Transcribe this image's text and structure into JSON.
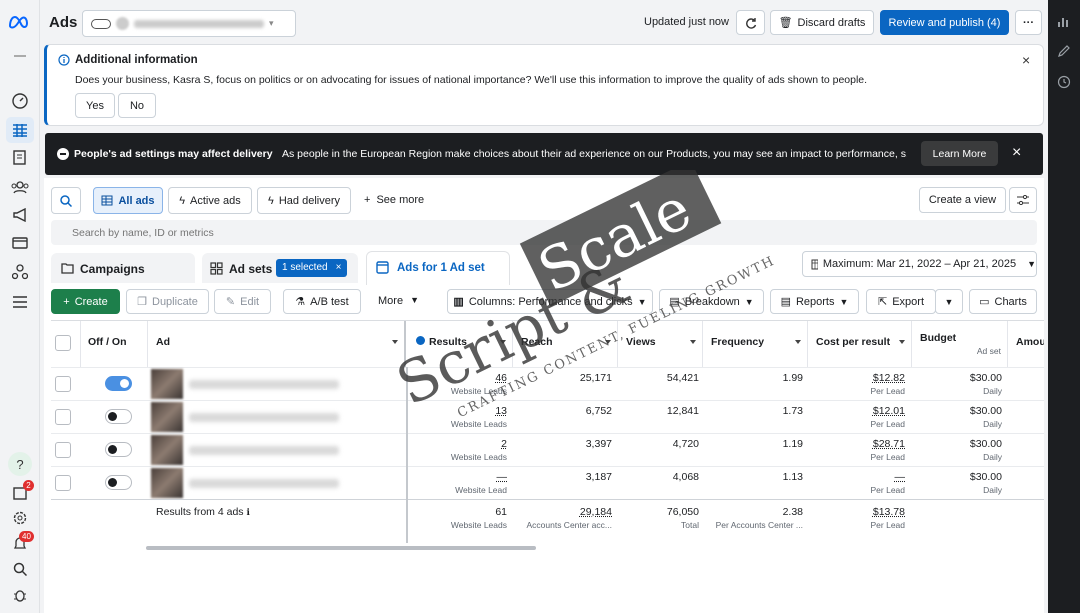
{
  "topbar": {
    "title": "Ads",
    "updated": "Updated just now",
    "discard": "Discard drafts",
    "review": "Review and publish (4)"
  },
  "info": {
    "title": "Additional information",
    "text": "Does your business, Kasra S, focus on politics or on advocating for issues of national importance? We'll use this information to improve the quality of ads shown to people.",
    "yes": "Yes",
    "no": "No"
  },
  "eu": {
    "title": "People's ad settings may affect delivery",
    "text": "As people in the European Region make choices about their ad experience on our Products, you may see an impact to performance, s...",
    "learn": "Learn More"
  },
  "filters": {
    "all": "All ads",
    "active": "Active ads",
    "had": "Had delivery",
    "more": "See more",
    "create_view": "Create a view",
    "search_placeholder": "Search by name, ID or metrics"
  },
  "levels": {
    "campaigns": "Campaigns",
    "adsets": "Ad sets",
    "selected": "1 selected",
    "ads": "Ads for 1 Ad set",
    "date": "Maximum: Mar 21, 2022 – Apr 21, 2025"
  },
  "toolbar": {
    "create": "Create",
    "duplicate": "Duplicate",
    "edit": "Edit",
    "ab": "A/B test",
    "more": "More",
    "columns": "Columns: Performance and clicks",
    "breakdown": "Breakdown",
    "reports": "Reports",
    "export": "Export",
    "charts": "Charts"
  },
  "table": {
    "headers": {
      "offon": "Off / On",
      "ad": "Ad",
      "results": "Results",
      "reach": "Reach",
      "views": "Views",
      "frequency": "Frequency",
      "cpr": "Cost per result",
      "budget": "Budget",
      "budget_sub": "Ad set",
      "amount": "Amou"
    },
    "rows": [
      {
        "results": "46",
        "results_sub": "Website Leads",
        "reach": "25,171",
        "views": "54,421",
        "freq": "1.99",
        "cpr": "$12.82",
        "cpr_sub": "Per Lead",
        "budget": "$30.00",
        "budget_sub": "Daily",
        "on": true
      },
      {
        "results": "13",
        "results_sub": "Website Leads",
        "reach": "6,752",
        "views": "12,841",
        "freq": "1.73",
        "cpr": "$12.01",
        "cpr_sub": "Per Lead",
        "budget": "$30.00",
        "budget_sub": "Daily",
        "on": false
      },
      {
        "results": "2",
        "results_sub": "Website Leads",
        "reach": "3,397",
        "views": "4,720",
        "freq": "1.19",
        "cpr": "$28.71",
        "cpr_sub": "Per Lead",
        "budget": "$30.00",
        "budget_sub": "Daily",
        "on": false
      },
      {
        "results": "—",
        "results_sub": "Website Lead",
        "reach": "3,187",
        "views": "4,068",
        "freq": "1.13",
        "cpr": "—",
        "cpr_sub": "Per Lead",
        "budget": "$30.00",
        "budget_sub": "Daily",
        "on": false
      }
    ],
    "totals": {
      "label": "Results from 4 ads",
      "results": "61",
      "results_sub": "Website Leads",
      "reach": "29,184",
      "reach_sub": "Accounts Center acc...",
      "views": "76,050",
      "views_sub": "Total",
      "freq": "2.38",
      "freq_sub": "Per Accounts Center ...",
      "cpr": "$13.78",
      "cpr_sub": "Per Lead"
    }
  },
  "sidebar": {
    "badge_notifications": "2",
    "badge_alerts": "40"
  },
  "watermark": {
    "main": "Script & Scale",
    "tagline": "CRAFTING CONTENT, FUELING GROWTH"
  }
}
